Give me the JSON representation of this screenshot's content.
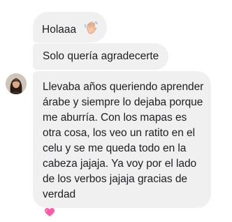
{
  "messages": [
    {
      "text": "Holaaa",
      "emoji": "waving-hand-icon"
    },
    {
      "text": "Solo quería agradecerte"
    },
    {
      "text": "Llevaba años queriendo aprender árabe y siempre lo dejaba porque me aburría. Con los mapas es otra cosa, los veo un ratito en el celu y se me queda todo en la cabeza jajaja. Ya voy por el lado de los verbos jajaja gracias de verdad",
      "emoji": "pink-heart-icon"
    }
  ],
  "colors": {
    "bubble": "#f0f0f0",
    "text": "#1c1e21",
    "heart": "#ff5aa8"
  }
}
